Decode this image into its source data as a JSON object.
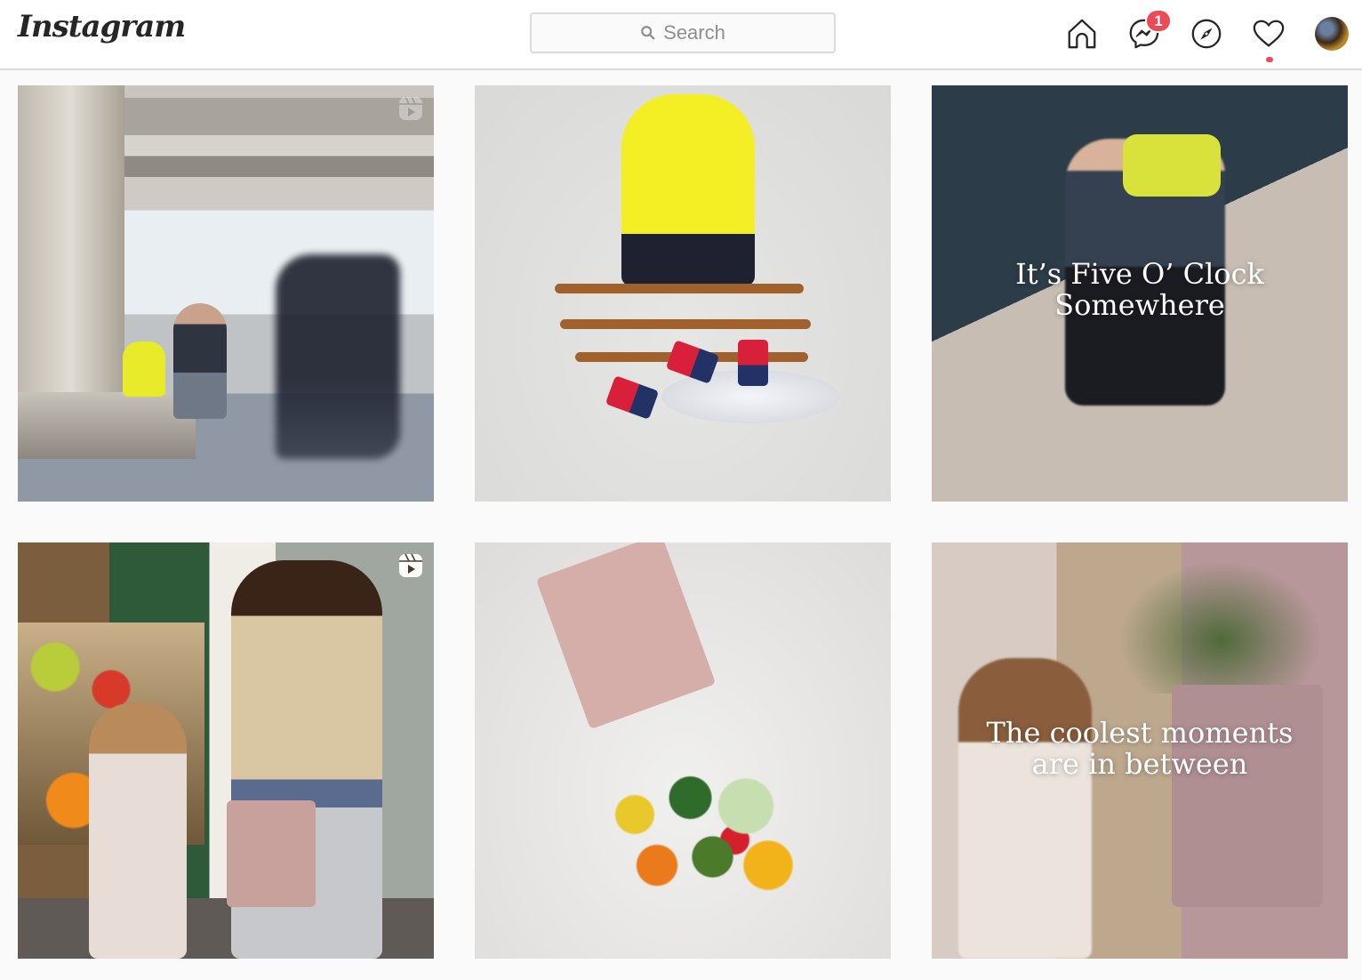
{
  "header": {
    "logo": "Instagram",
    "search": {
      "placeholder": "Search",
      "value": ""
    },
    "nav": {
      "home": "home-icon",
      "direct": "messenger-icon",
      "direct_badge": "1",
      "explore": "compass-icon",
      "activity": "heart-icon",
      "activity_has_notification": true,
      "profile": "avatar"
    },
    "colors": {
      "badge": "#ed4956",
      "border": "#dbdbdb",
      "text": "#262626",
      "muted": "#8e8e8e"
    }
  },
  "grid": {
    "posts": [
      {
        "type": "reel",
        "description": "Skateboarder rushing past man seated with yellow backpack under overpass",
        "overlay_text": ""
      },
      {
        "type": "photo",
        "description": "Yellow backpack on stacked skateboards with cans in ice",
        "overlay_text": ""
      },
      {
        "type": "photo",
        "description": "Skateboarder with yellow backpack",
        "overlay_text_line1": "It’s Five O’ Clock",
        "overlay_text_line2": "Somewhere"
      },
      {
        "type": "reel",
        "description": "Child holding melon and woman with pink tote at fruit market",
        "overlay_text": ""
      },
      {
        "type": "photo",
        "description": "Pink tote bag spilling vegetables",
        "overlay_text": ""
      },
      {
        "type": "photo",
        "description": "Child and adult with pink tote holding greens",
        "overlay_text_line1": "The coolest moments",
        "overlay_text_line2": "are in between"
      }
    ]
  }
}
